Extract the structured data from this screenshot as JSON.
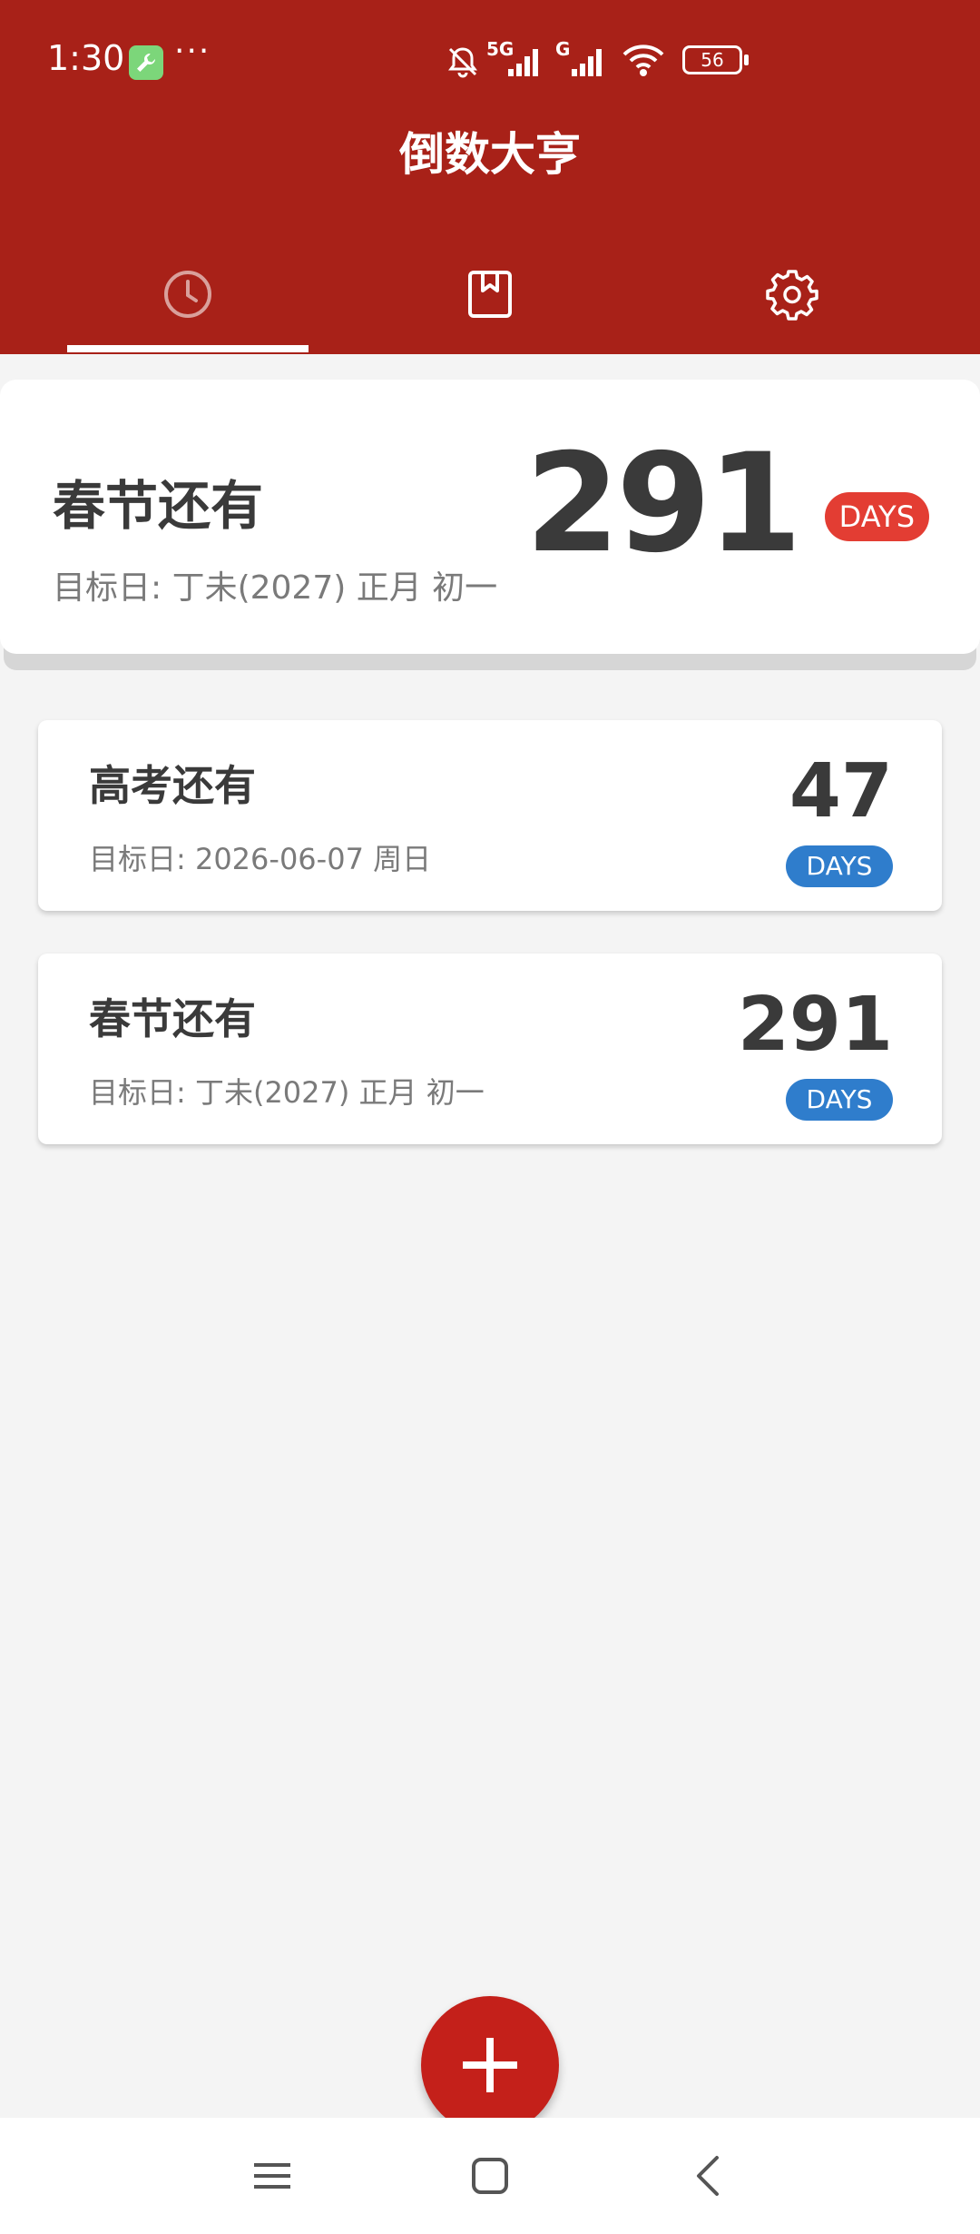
{
  "status_bar": {
    "time": "1:30",
    "more": "···",
    "network_5g": "5G",
    "network_g": "G",
    "battery": "56"
  },
  "app": {
    "title": "倒数大亨"
  },
  "tabs": [
    {
      "name": "countdown",
      "icon": "clock-icon",
      "selected": true
    },
    {
      "name": "bookmarks",
      "icon": "bookmark-icon",
      "selected": false
    },
    {
      "name": "settings",
      "icon": "gear-icon",
      "selected": false
    }
  ],
  "hero": {
    "title": "春节还有",
    "subtitle": "目标日: 丁未(2027) 正月 初一",
    "days": "291",
    "badge": "DAYS"
  },
  "events": [
    {
      "title": "高考还有",
      "subtitle": "目标日: 2026-06-07 周日",
      "days": "47",
      "badge": "DAYS"
    },
    {
      "title": "春节还有",
      "subtitle": "目标日: 丁未(2027) 正月 初一",
      "days": "291",
      "badge": "DAYS"
    }
  ],
  "colors": {
    "primary": "#a82118",
    "hero_badge": "#e33d33",
    "list_badge": "#2f7dcc",
    "fab": "#c4201a",
    "background": "#f4f4f4"
  }
}
